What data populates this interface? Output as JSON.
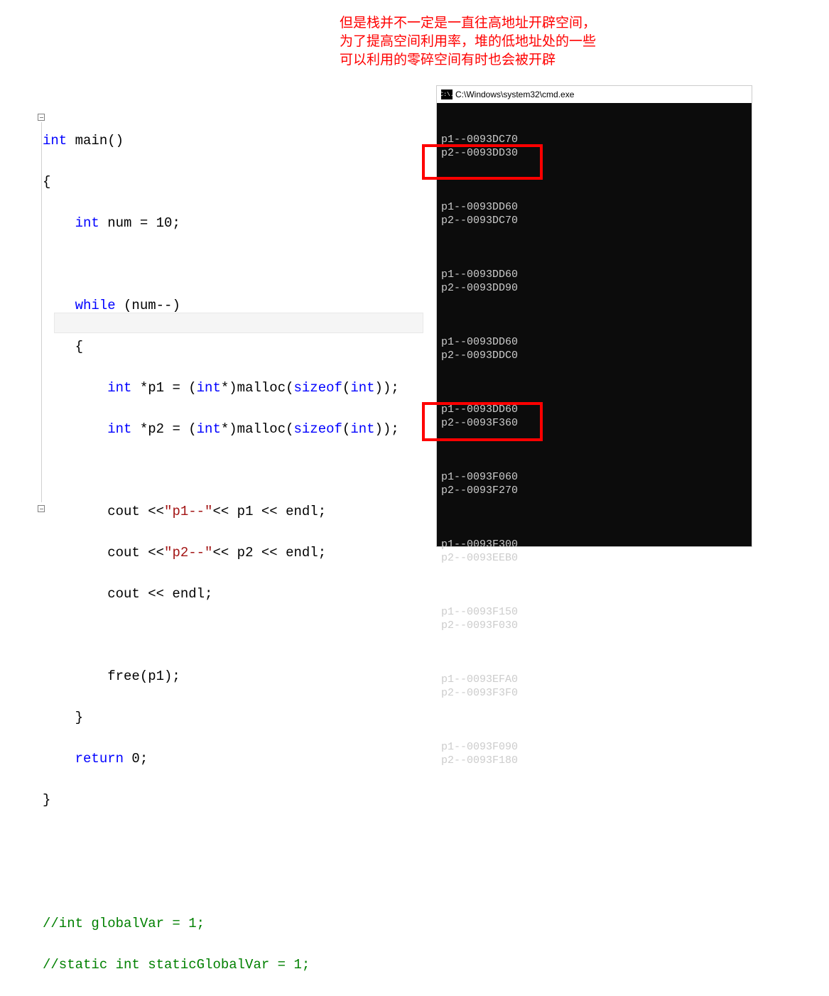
{
  "annotation": {
    "line1": "但是栈并不一定是一直往高地址开辟空间，",
    "line2": "为了提高空间利用率，堆的低地址处的一些",
    "line3": "可以利用的零碎空间有时也会被开辟"
  },
  "code": {
    "l1_kw": "int",
    "l1_fn": " main()",
    "l2": "{",
    "l3_type": "int",
    "l3_rest": " num = 10;",
    "l4_kw": "while",
    "l4_rest": " (num--)",
    "l5": "{",
    "l6_type1": "int",
    "l6_mid": " *p1 = (",
    "l6_type2": "int",
    "l6_mid2": "*)malloc(",
    "l6_sizeof": "sizeof",
    "l6_type3": "int",
    "l6_end": "));",
    "l7_type1": "int",
    "l7_mid": " *p2 = (",
    "l7_type2": "int",
    "l7_mid2": "*)malloc(",
    "l7_sizeof": "sizeof",
    "l7_type3": "int",
    "l7_end": "));",
    "l8_a": "cout <<",
    "l8_str": "\"p1--\"",
    "l8_b": "<< p1 << endl;",
    "l9_a": "cout <<",
    "l9_str": "\"p2--\"",
    "l9_b": "<< p2 << endl;",
    "l10": "cout << endl;",
    "l11": "free(p1);",
    "l12": "}",
    "l13_kw": "return",
    "l13_rest": " 0;",
    "l14": "}",
    "c1": "//int globalVar = 1;",
    "c2": "//static int staticGlobalVar = 1;"
  },
  "console": {
    "title": "C:\\Windows\\system32\\cmd.exe",
    "icon_text": "C:\\.",
    "blocks": [
      [
        "p1--0093DC70",
        "p2--0093DD30"
      ],
      [
        "p1--0093DD60",
        "p2--0093DC70"
      ],
      [
        "p1--0093DD60",
        "p2--0093DD90"
      ],
      [
        "p1--0093DD60",
        "p2--0093DDC0"
      ],
      [
        "p1--0093DD60",
        "p2--0093F360"
      ],
      [
        "p1--0093F060",
        "p2--0093F270"
      ],
      [
        "p1--0093F300",
        "p2--0093EEB0"
      ],
      [
        "p1--0093F150",
        "p2--0093F030"
      ],
      [
        "p1--0093EFA0",
        "p2--0093F3F0"
      ],
      [
        "p1--0093F090",
        "p2--0093F180"
      ]
    ]
  }
}
